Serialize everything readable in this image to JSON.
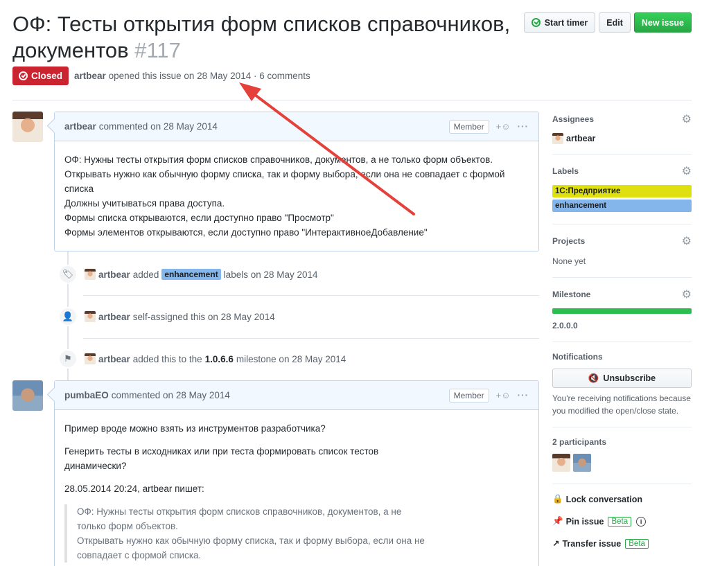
{
  "issue": {
    "title": "ОФ: Тесты открытия форм списков справочников, документов",
    "number": "#117",
    "state": "Closed",
    "author": "artbear",
    "opened_text": "opened this issue on 28 May 2014 · 6 comments"
  },
  "header_actions": {
    "start_timer": "Start timer",
    "edit": "Edit",
    "new_issue": "New issue"
  },
  "comments": [
    {
      "author": "artbear",
      "meta": "commented on 28 May 2014",
      "role": "Member",
      "lines": [
        "ОФ: Нужны тесты открытия форм списков справочников, документов, а не только форм объектов.",
        "Открывать нужно как обычную форму списка, так и форму выбора, если она не совпадает с формой списка",
        "Должны учитываться права доступа.",
        "Формы списка открываются, если доступно право \"Просмотр\"",
        "Формы элементов открываются, если доступно право \"ИнтерактивноеДобавление\""
      ]
    },
    {
      "author": "pumbaEO",
      "meta": "commented on 28 May 2014",
      "role": "Member",
      "p1": "Пример вроде можно взять из инструментов разработчика?",
      "p2": "Генерить тесты в исходниках или при теста формировать список тестов динамически?",
      "p3": "28.05.2014 20:24, artbear пишет:",
      "quote": [
        "ОФ: Нужны тесты открытия форм списков справочников, документов, а не только форм объектов.",
        "Открывать нужно как обычную форму списка, так и форму выбора, если она не совпадает с формой списка."
      ]
    }
  ],
  "events": [
    {
      "icon": "tag-icon",
      "author": "artbear",
      "before": "added",
      "label": "enhancement",
      "after": "labels on 28 May 2014"
    },
    {
      "icon": "person-icon",
      "author": "artbear",
      "text": "self-assigned this on 28 May 2014"
    },
    {
      "icon": "milestone-icon",
      "author": "artbear",
      "before": "added this to the",
      "milestone": "1.0.6.6",
      "after": "milestone on 28 May 2014"
    }
  ],
  "sidebar": {
    "assignees_title": "Assignees",
    "assignee": "artbear",
    "labels_title": "Labels",
    "labels": [
      {
        "name": "1С:Предприятие",
        "color": "#dfe010"
      },
      {
        "name": "enhancement",
        "color": "#84b6eb"
      }
    ],
    "projects_title": "Projects",
    "projects_value": "None yet",
    "milestone_title": "Milestone",
    "milestone_progress": 1.0,
    "milestone_value": "2.0.0.0",
    "notifications_title": "Notifications",
    "unsubscribe": "Unsubscribe",
    "notifications_text": "You're receiving notifications because you modified the open/close state.",
    "participants_title": "2 participants",
    "lock": "Lock conversation",
    "pin": "Pin issue",
    "transfer": "Transfer issue",
    "beta": "Beta"
  },
  "colors": {
    "closed": "#cb2431",
    "green": "#2cbe4e",
    "arrow": "#e5413b"
  }
}
